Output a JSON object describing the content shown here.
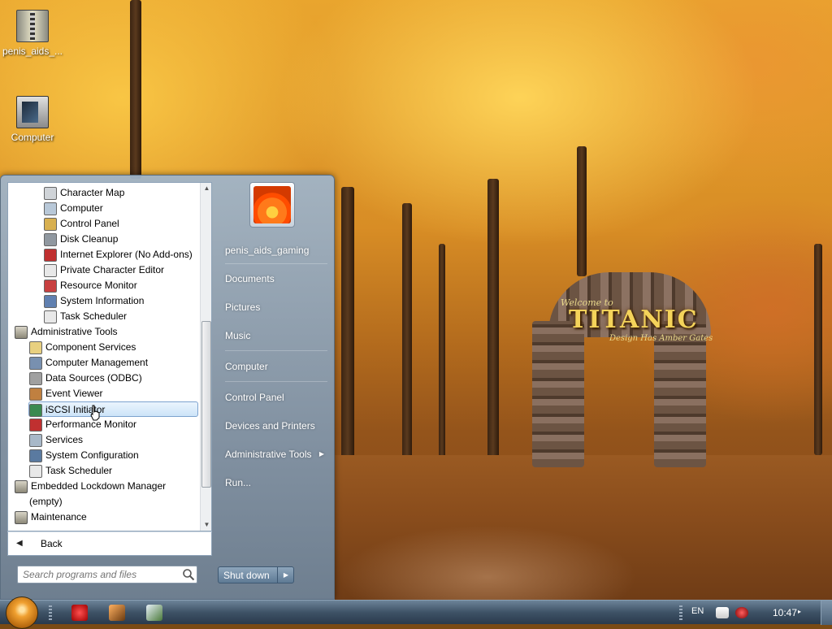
{
  "desktop": {
    "icons": [
      {
        "label": "penis_aids_..."
      },
      {
        "label": "Computer"
      }
    ],
    "wallpaper": {
      "line1": "Welcome to",
      "title": "TITANIC",
      "line2": "Design Has Amber Gates"
    }
  },
  "start_menu": {
    "programs": [
      {
        "label": "Character Map",
        "icon": "character-map-icon",
        "indent": 2
      },
      {
        "label": "Computer",
        "icon": "computer-icon",
        "indent": 2
      },
      {
        "label": "Control Panel",
        "icon": "control-panel-icon",
        "indent": 2
      },
      {
        "label": "Disk Cleanup",
        "icon": "disk-cleanup-icon",
        "indent": 2
      },
      {
        "label": "Internet Explorer (No Add-ons)",
        "icon": "internet-explorer-icon",
        "indent": 2
      },
      {
        "label": "Private Character Editor",
        "icon": "character-editor-icon",
        "indent": 2
      },
      {
        "label": "Resource Monitor",
        "icon": "resource-monitor-icon",
        "indent": 2
      },
      {
        "label": "System Information",
        "icon": "system-information-icon",
        "indent": 2
      },
      {
        "label": "Task Scheduler",
        "icon": "task-scheduler-icon",
        "indent": 2
      },
      {
        "label": "Administrative Tools",
        "icon": "folder-icon",
        "indent": 0
      },
      {
        "label": "Component Services",
        "icon": "component-services-icon",
        "indent": 1
      },
      {
        "label": "Computer Management",
        "icon": "computer-management-icon",
        "indent": 1
      },
      {
        "label": "Data Sources (ODBC)",
        "icon": "data-sources-icon",
        "indent": 1
      },
      {
        "label": "Event Viewer",
        "icon": "event-viewer-icon",
        "indent": 1
      },
      {
        "label": "iSCSI Initiator",
        "icon": "iscsi-initiator-icon",
        "indent": 1,
        "selected": true
      },
      {
        "label": "Performance Monitor",
        "icon": "performance-monitor-icon",
        "indent": 1
      },
      {
        "label": "Services",
        "icon": "services-icon",
        "indent": 1
      },
      {
        "label": "System Configuration",
        "icon": "system-configuration-icon",
        "indent": 1
      },
      {
        "label": "Task Scheduler",
        "icon": "task-scheduler-icon",
        "indent": 1
      },
      {
        "label": "Embedded Lockdown Manager",
        "icon": "folder-icon",
        "indent": 0
      },
      {
        "label": "(empty)",
        "icon": "",
        "indent": 1
      },
      {
        "label": "Maintenance",
        "icon": "folder-icon",
        "indent": 0
      }
    ],
    "back_label": "Back",
    "search_placeholder": "Search programs and files",
    "right_items": [
      {
        "label": "penis_aids_gaming"
      },
      {
        "label": "Documents"
      },
      {
        "label": "Pictures"
      },
      {
        "label": "Music"
      },
      {
        "label": "Computer"
      },
      {
        "label": "Control Panel"
      },
      {
        "label": "Devices and Printers"
      },
      {
        "label": "Administrative Tools",
        "submenu": true
      },
      {
        "label": "Run..."
      }
    ],
    "shutdown_label": "Shut down"
  },
  "taskbar": {
    "language": "EN",
    "clock": "10:47"
  }
}
